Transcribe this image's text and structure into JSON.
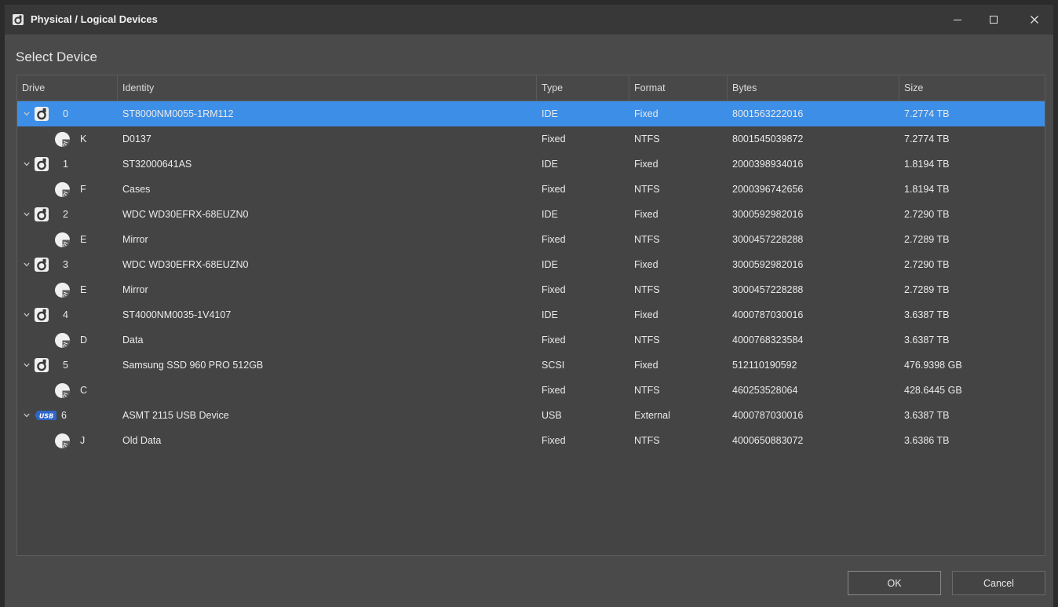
{
  "window": {
    "title": "Physical / Logical Devices",
    "section_title": "Select Device"
  },
  "columns": [
    "Drive",
    "Identity",
    "Type",
    "Format",
    "Bytes",
    "Size"
  ],
  "rows": [
    {
      "level": "disk",
      "icon": "hard-disk-icon",
      "drive": "0",
      "identity": "ST8000NM0055-1RM112",
      "type": "IDE",
      "format": "Fixed",
      "bytes": "8001563222016",
      "size": "7.2774 TB",
      "selected": true
    },
    {
      "level": "partition",
      "icon": "partition-icon",
      "drive": "K",
      "identity": "D0137",
      "type": "Fixed",
      "format": "NTFS",
      "bytes": "8001545039872",
      "size": "7.2774 TB"
    },
    {
      "level": "disk",
      "icon": "hard-disk-icon",
      "drive": "1",
      "identity": "ST32000641AS",
      "type": "IDE",
      "format": "Fixed",
      "bytes": "2000398934016",
      "size": "1.8194 TB"
    },
    {
      "level": "partition",
      "icon": "partition-icon",
      "drive": "F",
      "identity": "Cases",
      "type": "Fixed",
      "format": "NTFS",
      "bytes": "2000396742656",
      "size": "1.8194 TB"
    },
    {
      "level": "disk",
      "icon": "hard-disk-icon",
      "drive": "2",
      "identity": "WDC WD30EFRX-68EUZN0",
      "type": "IDE",
      "format": "Fixed",
      "bytes": "3000592982016",
      "size": "2.7290 TB"
    },
    {
      "level": "partition",
      "icon": "partition-icon",
      "drive": "E",
      "identity": "Mirror",
      "type": "Fixed",
      "format": "NTFS",
      "bytes": "3000457228288",
      "size": "2.7289 TB"
    },
    {
      "level": "disk",
      "icon": "hard-disk-icon",
      "drive": "3",
      "identity": "WDC WD30EFRX-68EUZN0",
      "type": "IDE",
      "format": "Fixed",
      "bytes": "3000592982016",
      "size": "2.7290 TB"
    },
    {
      "level": "partition",
      "icon": "partition-icon",
      "drive": "E",
      "identity": "Mirror",
      "type": "Fixed",
      "format": "NTFS",
      "bytes": "3000457228288",
      "size": "2.7289 TB"
    },
    {
      "level": "disk",
      "icon": "hard-disk-icon",
      "drive": "4",
      "identity": "ST4000NM0035-1V4107",
      "type": "IDE",
      "format": "Fixed",
      "bytes": "4000787030016",
      "size": "3.6387 TB"
    },
    {
      "level": "partition",
      "icon": "partition-icon",
      "drive": "D",
      "identity": "Data",
      "type": "Fixed",
      "format": "NTFS",
      "bytes": "4000768323584",
      "size": "3.6387 TB"
    },
    {
      "level": "disk",
      "icon": "hard-disk-icon",
      "drive": "5",
      "identity": "Samsung SSD 960 PRO 512GB",
      "type": "SCSI",
      "format": "Fixed",
      "bytes": "512110190592",
      "size": "476.9398 GB"
    },
    {
      "level": "partition",
      "icon": "partition-icon",
      "drive": "C",
      "identity": "",
      "type": "Fixed",
      "format": "NTFS",
      "bytes": "460253528064",
      "size": "428.6445 GB"
    },
    {
      "level": "disk",
      "icon": "usb-drive-icon",
      "drive": "6",
      "identity": "ASMT 2115 USB Device",
      "type": "USB",
      "format": "External",
      "bytes": "4000787030016",
      "size": "3.6387 TB"
    },
    {
      "level": "partition",
      "icon": "partition-icon",
      "drive": "J",
      "identity": "Old Data",
      "type": "Fixed",
      "format": "NTFS",
      "bytes": "4000650883072",
      "size": "3.6386 TB"
    }
  ],
  "usb_badge": "USB",
  "buttons": {
    "ok": "OK",
    "cancel": "Cancel"
  },
  "colors": {
    "selection": "#3d8ee6",
    "window_bg": "#4a4a4a",
    "titlebar_bg": "#383838"
  }
}
